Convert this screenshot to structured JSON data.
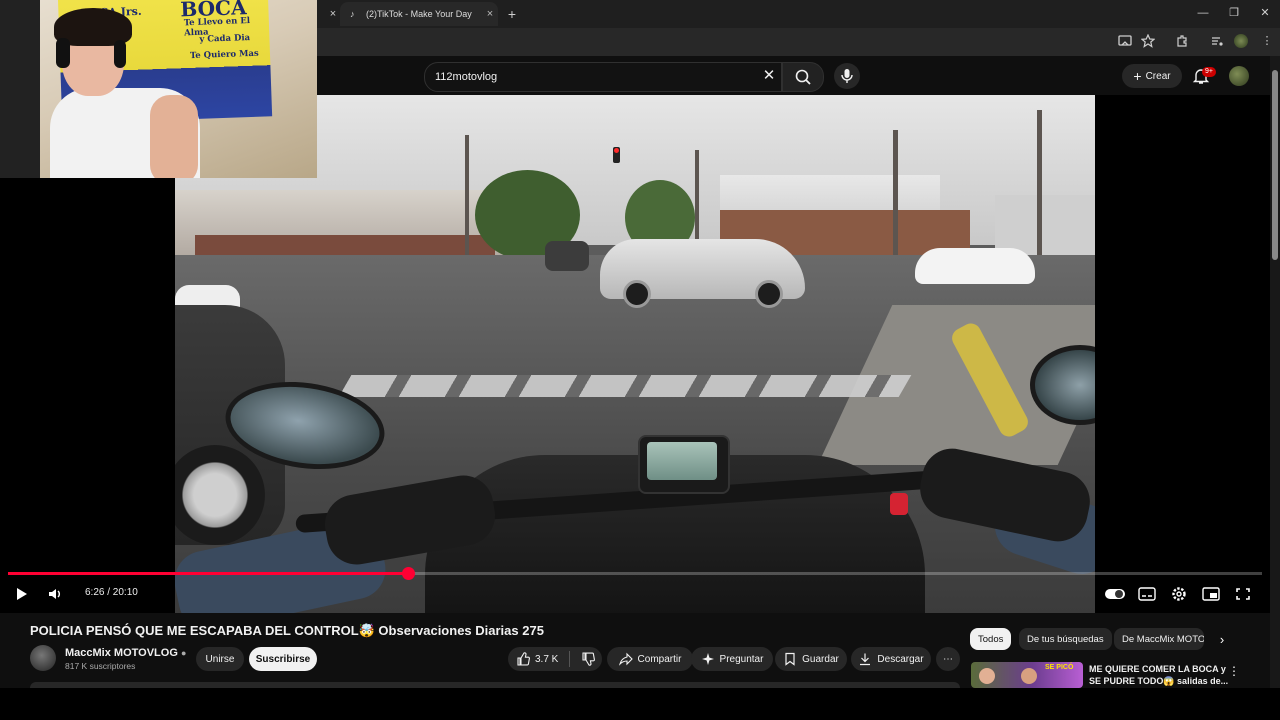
{
  "browser": {
    "tab_title": "(2)TikTok - Make Your Day",
    "tab_close": "×",
    "new_tab": "+",
    "window_minimize": "—",
    "window_restore": "❐",
    "window_close": "✕"
  },
  "webcam": {
    "flag_line1": "BOCA Jrs.",
    "flag_brand": "BOCA",
    "flag_line2": "Te Llevo en El Alma",
    "flag_line3": "y Cada Dia",
    "flag_line4": "Te Quiero Mas"
  },
  "header": {
    "search_query": "112motovlog",
    "create_label": "Crear",
    "notification_badge": "9+",
    "icons": [
      "search-icon",
      "microphone-icon",
      "bell-icon",
      "clear-icon"
    ]
  },
  "player": {
    "current_time": "6:26",
    "duration": "20:10",
    "time_display": "6:26 / 20:10",
    "progress": 0.319,
    "accent_color": "#ff0033"
  },
  "video": {
    "title": "POLICIA PENSÓ QUE ME ESCAPABA DEL CONTROL🤯 Observaciones Diarias 275",
    "channel_name": "MaccMix MOTOVLOG",
    "subscribers": "817 K suscriptores",
    "join_label": "Unirse",
    "subscribe_label": "Suscribirse",
    "like_count": "3.7 K",
    "share_label": "Compartir",
    "ask_label": "Preguntar",
    "save_label": "Guardar",
    "download_label": "Descargar"
  },
  "recommendations": {
    "chips": [
      "Todos",
      "De tus búsquedas",
      "De MaccMix MOTO"
    ],
    "item_title": "ME QUIERE COMER LA BOCA y SE PUDRE TODO😱 salidas de...",
    "thumb_text": "SE PICÓ"
  }
}
